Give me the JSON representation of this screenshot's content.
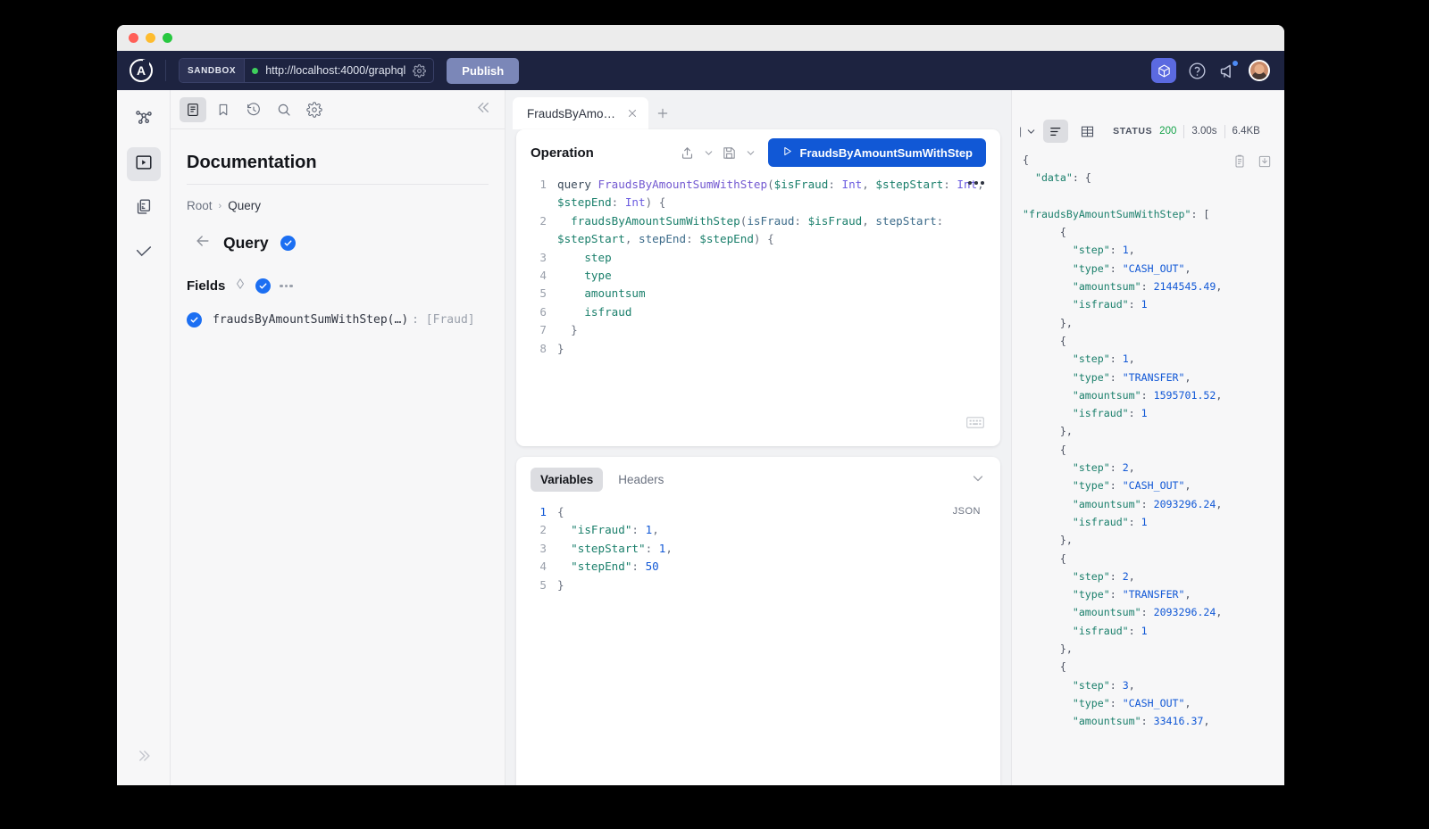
{
  "window": {
    "traffic_lights": [
      "close",
      "minimize",
      "maximize"
    ]
  },
  "topnav": {
    "logo": "A",
    "sandbox_label": "SANDBOX",
    "endpoint_url": "http://localhost:4000/graphql",
    "endpoint_status": "connected",
    "settings_icon": "gear-icon",
    "publish_label": "Publish",
    "right_icons": [
      "cube-icon",
      "help-icon",
      "megaphone-icon",
      "avatar"
    ],
    "colors": {
      "bar_bg": "#1d2340",
      "publish_bg": "#7b87b8",
      "cube_bg": "#5b6ae0",
      "status_dot": "#3ecf5c"
    }
  },
  "rail": {
    "items": [
      {
        "name": "schema-graph-icon",
        "active": false
      },
      {
        "name": "explorer-play-icon",
        "active": true
      },
      {
        "name": "collections-icon",
        "active": false
      },
      {
        "name": "checks-icon",
        "active": false
      }
    ],
    "expand_label": "expand-rail"
  },
  "doc_panel": {
    "toolbar": [
      {
        "name": "documentation-icon",
        "active": true
      },
      {
        "name": "bookmark-icon",
        "active": false
      },
      {
        "name": "history-icon",
        "active": false
      },
      {
        "name": "search-icon",
        "active": false
      },
      {
        "name": "settings-gear-icon",
        "active": false
      }
    ],
    "collapse_label": "collapse-panel",
    "title": "Documentation",
    "breadcrumb": {
      "root": "Root",
      "separator": "›",
      "current": "Query"
    },
    "type_name": "Query",
    "fields_label": "Fields",
    "fields": [
      {
        "signature": "fraudsByAmountSumWithStep(…)",
        "return_type": ": [Fraud]",
        "checked": true
      }
    ]
  },
  "tabs": {
    "items": [
      {
        "label": "FraudsByAmo…",
        "active": true
      }
    ],
    "add_label": "+"
  },
  "operation": {
    "title": "Operation",
    "share_icon": "share-icon",
    "save_icon": "save-icon",
    "run_label": "FraudsByAmountSumWithStep",
    "more_icon": "more-horizontal-icon",
    "keyboard_icon": "keyboard-icon",
    "code_lines": [
      {
        "n": "1",
        "text": "query FraudsByAmountSumWithStep($isFraud: Int, $stepStart: Int, $stepEnd: Int) {"
      },
      {
        "n": "2",
        "text": "  fraudsByAmountSumWithStep(isFraud: $isFraud, stepStart: $stepStart, stepEnd: $stepEnd) {"
      },
      {
        "n": "3",
        "text": "    step"
      },
      {
        "n": "4",
        "text": "    type"
      },
      {
        "n": "5",
        "text": "    amountsum"
      },
      {
        "n": "6",
        "text": "    isfraud"
      },
      {
        "n": "7",
        "text": "  }"
      },
      {
        "n": "8",
        "text": "}"
      }
    ]
  },
  "variables": {
    "tabs": [
      {
        "label": "Variables",
        "active": true
      },
      {
        "label": "Headers",
        "active": false
      }
    ],
    "format_badge": "JSON",
    "collapse_icon": "chevron-down-icon",
    "lines": [
      {
        "n": "1",
        "text": "{"
      },
      {
        "n": "2",
        "text": "  \"isFraud\": 1,"
      },
      {
        "n": "3",
        "text": "  \"stepStart\": 1,"
      },
      {
        "n": "4",
        "text": "  \"stepEnd\": 50"
      },
      {
        "n": "5",
        "text": "}"
      }
    ],
    "values": {
      "isFraud": 1,
      "stepStart": 1,
      "stepEnd": 50
    }
  },
  "response": {
    "selector_label": "|",
    "view_buttons": [
      {
        "name": "json-view-icon",
        "active": true
      },
      {
        "name": "table-view-icon",
        "active": false
      }
    ],
    "status_label": "STATUS",
    "status_code": "200",
    "duration": "3.00s",
    "size": "6.4KB",
    "copy_icon": "copy-icon",
    "download_icon": "download-icon",
    "lines": [
      "{",
      "  \"data\": {",
      "",
      "\"fraudsByAmountSumWithStep\": [",
      "      {",
      "        \"step\": 1,",
      "        \"type\": \"CASH_OUT\",",
      "        \"amountsum\": 2144545.49,",
      "        \"isfraud\": 1",
      "      },",
      "      {",
      "        \"step\": 1,",
      "        \"type\": \"TRANSFER\",",
      "        \"amountsum\": 1595701.52,",
      "        \"isfraud\": 1",
      "      },",
      "      {",
      "        \"step\": 2,",
      "        \"type\": \"CASH_OUT\",",
      "        \"amountsum\": 2093296.24,",
      "        \"isfraud\": 1",
      "      },",
      "      {",
      "        \"step\": 2,",
      "        \"type\": \"TRANSFER\",",
      "        \"amountsum\": 2093296.24,",
      "        \"isfraud\": 1",
      "      },",
      "      {",
      "        \"step\": 3,",
      "        \"type\": \"CASH_OUT\",",
      "        \"amountsum\": 33416.37,"
    ],
    "records": [
      {
        "step": 1,
        "type": "CASH_OUT",
        "amountsum": 2144545.49,
        "isfraud": 1
      },
      {
        "step": 1,
        "type": "TRANSFER",
        "amountsum": 1595701.52,
        "isfraud": 1
      },
      {
        "step": 2,
        "type": "CASH_OUT",
        "amountsum": 2093296.24,
        "isfraud": 1
      },
      {
        "step": 2,
        "type": "TRANSFER",
        "amountsum": 2093296.24,
        "isfraud": 1
      },
      {
        "step": 3,
        "type": "CASH_OUT",
        "amountsum": 33416.37,
        "isfraud": null
      }
    ]
  }
}
